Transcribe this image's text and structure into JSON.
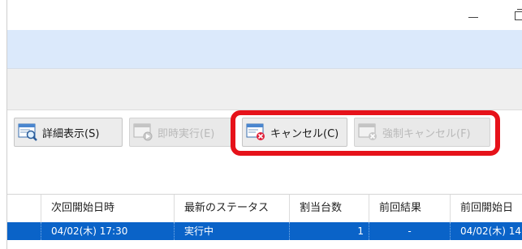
{
  "window": {
    "minimize_glyph": "—",
    "restore_glyph": "restore"
  },
  "toolbar": {
    "details_label": "詳細表示(S)",
    "run_now_label": "即時実行(E)",
    "cancel_label": "キャンセル(C)",
    "force_cancel_label": "強制キャンセル(F)"
  },
  "grid": {
    "columns": [
      "次回開始日時",
      "最新のステータス",
      "割当台数",
      "前回結果",
      "前回開始日"
    ],
    "rows": [
      {
        "next_start": "04/02(木) 17:30",
        "status": "実行中",
        "assigned": "1",
        "last_result": "-",
        "last_start": "04/02(木) 14"
      }
    ]
  },
  "colors": {
    "selection": "#0a63c8",
    "callout": "#e6121a",
    "band_blue": "#dbe9fb"
  }
}
